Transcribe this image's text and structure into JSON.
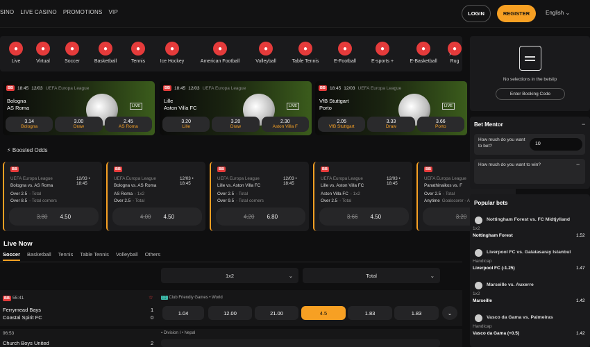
{
  "nav": {
    "casino": "SINO",
    "live_casino": "LIVE CASINO",
    "promotions": "PROMOTIONS",
    "vip": "VIP",
    "login": "LOGIN",
    "register": "REGISTER",
    "language": "English"
  },
  "sports": [
    "Live",
    "Virtual",
    "Soccer",
    "Basketball",
    "Tennis",
    "Ice Hockey",
    "American Football",
    "Volleyball",
    "Table Tennis",
    "E-Football",
    "E-sports +",
    "E-Basketball",
    "Rug"
  ],
  "featured": [
    {
      "time": "18:45",
      "date": "12/03",
      "league": "UEFA Europa League",
      "home": "Bologna",
      "away": "AS Roma",
      "o1": "3.14",
      "l1": "Bologna",
      "o2": "3.00",
      "l2": "Draw",
      "o3": "2.45",
      "l3": "AS Roma"
    },
    {
      "time": "18:45",
      "date": "12/03",
      "league": "UEFA Europa League",
      "home": "Lille",
      "away": "Aston Villa FC",
      "o1": "3.20",
      "l1": "Lille",
      "o2": "3.20",
      "l2": "Draw",
      "o3": "2.30",
      "l3": "Aston Villa F"
    },
    {
      "time": "18:45",
      "date": "12/03",
      "league": "UEFA Europa League",
      "home": "VfB Stuttgart",
      "away": "Porto",
      "o1": "2.05",
      "l1": "VfB Stuttgart",
      "o2": "3.33",
      "l2": "Draw",
      "o3": "3.66",
      "l3": "Porto"
    }
  ],
  "live_tag": "LIVE",
  "bb_tag": "BB",
  "boosted_title": "Boosted Odds",
  "boosted": [
    {
      "league": "UEFA Europa League",
      "datetime": "12/03 • 18:45",
      "match": "Bologna vs. AS Roma",
      "leg1": "Over 2.5",
      "leg1b": "- Total",
      "leg2": "Over 8.5",
      "leg2b": "- Total corners",
      "old": "3.80",
      "new": "4.50"
    },
    {
      "league": "UEFA Europa League",
      "datetime": "12/03 • 18:45",
      "match": "Bologna vs. AS Roma",
      "leg1": "AS Roma",
      "leg1b": "- 1x2",
      "leg2": "Over 2.5",
      "leg2b": "- Total",
      "old": "4.00",
      "new": "4.50"
    },
    {
      "league": "UEFA Europa League",
      "datetime": "12/03 • 18:45",
      "match": "Lille vs. Aston Villa FC",
      "leg1": "Over 2.5",
      "leg1b": "- Total",
      "leg2": "Over 9.5",
      "leg2b": "- Total corners",
      "old": "4.20",
      "new": "6.80"
    },
    {
      "league": "UEFA Europa League",
      "datetime": "12/03 • 18:45",
      "match": "Lille vs. Aston Villa FC",
      "leg1": "Aston Villa FC",
      "leg1b": "- 1x2",
      "leg2": "Over 2.5",
      "leg2b": "- Total",
      "old": "3.66",
      "new": "4.50"
    },
    {
      "league": "UEFA Europa League",
      "datetime": "12/03",
      "match": "Panathinaikos vs. F",
      "leg1": "Over 2.5",
      "leg1b": "- Total",
      "leg2": "Anytime",
      "leg2b": "Goalscorer - Andro",
      "old": "3.20",
      "new": ""
    }
  ],
  "live_now": {
    "title": "Live Now",
    "tabs": [
      "Soccer",
      "Basketball",
      "Tennis",
      "Table Tennis",
      "Volleyball",
      "Others"
    ],
    "market1": "1x2",
    "market2": "Total",
    "match1": {
      "time": "55:41",
      "home": "Ferrymead Bays",
      "away": "Coastal Spirit FC",
      "hs": "1",
      "as": "0",
      "league": "Club Friendly Games • World",
      "o": [
        "1.04",
        "12.00",
        "21.00",
        "4.5",
        "1.83",
        "1.83"
      ]
    },
    "match2": {
      "time": "96:53",
      "home": "Church Boys United",
      "hs": "2",
      "league": "Division I • Nepal"
    }
  },
  "betslip": {
    "empty": "No selections in the betslip",
    "code": "Enter Booking Code"
  },
  "mentor": {
    "title": "Bet Mentor",
    "q1": "How much do you want to bet?",
    "value": "10",
    "q2": "How much do you want to win?"
  },
  "popular": {
    "title": "Popular bets",
    "items": [
      {
        "match": "Nottingham Forest vs. FC Midtjylland",
        "market": "1x2",
        "pick": "Nottingham Forest",
        "odd": "1.52"
      },
      {
        "match": "Liverpool FC vs. Galatasaray Istanbul",
        "market": "Handicap",
        "pick": "Liverpool FC (-1.25)",
        "odd": "1.47"
      },
      {
        "match": "Marseille vs. Auxerre",
        "market": "1x2",
        "pick": "Marseille",
        "odd": "1.42"
      },
      {
        "match": "Vasco da Gama vs. Palmeiras",
        "market": "Handicap",
        "pick": "Vasco da Gama (+0.5)",
        "odd": "1.42"
      }
    ]
  }
}
